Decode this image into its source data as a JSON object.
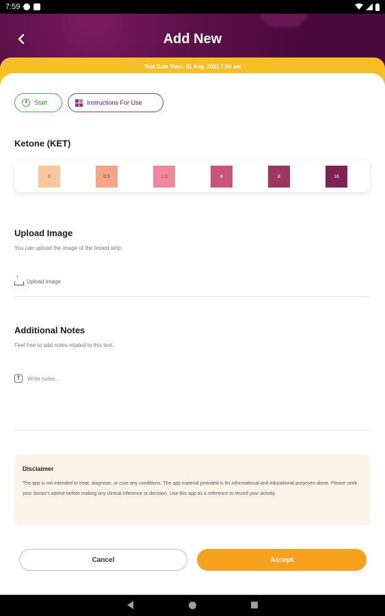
{
  "status_bar": {
    "time": "7:59",
    "icons": [
      "app-notification-icon",
      "clipboard-icon",
      "wifi-icon",
      "signal-icon",
      "battery-icon"
    ]
  },
  "header": {
    "title": "Add New",
    "back_icon": "chevron-left-icon",
    "date_label": "Test Date Time: 31 Aug, 2021 7:59 am"
  },
  "actions": {
    "start_label": "Start",
    "instructions_label": "Instructions For Use"
  },
  "test": {
    "title": "Ketone (KET)",
    "swatches": [
      {
        "label": "0",
        "color": "#f9c79e"
      },
      {
        "label": "0.5",
        "color": "#f5a588"
      },
      {
        "label": "1.5",
        "color": "#f0879a"
      },
      {
        "label": "4",
        "color": "#c8567a"
      },
      {
        "label": "8",
        "color": "#9c3663"
      },
      {
        "label": "16",
        "color": "#7d2354"
      }
    ]
  },
  "upload": {
    "title": "Upload Image",
    "subtitle": "You can upload the image of the tested strip.",
    "button_label": "Upload Image"
  },
  "notes": {
    "title": "Additional Notes",
    "subtitle": "Feel free to add notes related to this test.",
    "placeholder": "Write notes..."
  },
  "disclaimer": {
    "title": "Disclaimer",
    "text": "The app is not intended to treat, diagnose, or cure any conditions. The app material provided is for informational and educational purposes alone. Please seek your doctor's advice before making any clinical inference or decision. Use this app as a reference to record your activity."
  },
  "buttons": {
    "cancel_label": "Cancel",
    "accept_label": "Accept"
  },
  "colors": {
    "header_purple": "#4b0a3e",
    "accent_yellow": "#f6bf26",
    "accept_orange": "#f7a21f",
    "start_green": "#43b047"
  }
}
